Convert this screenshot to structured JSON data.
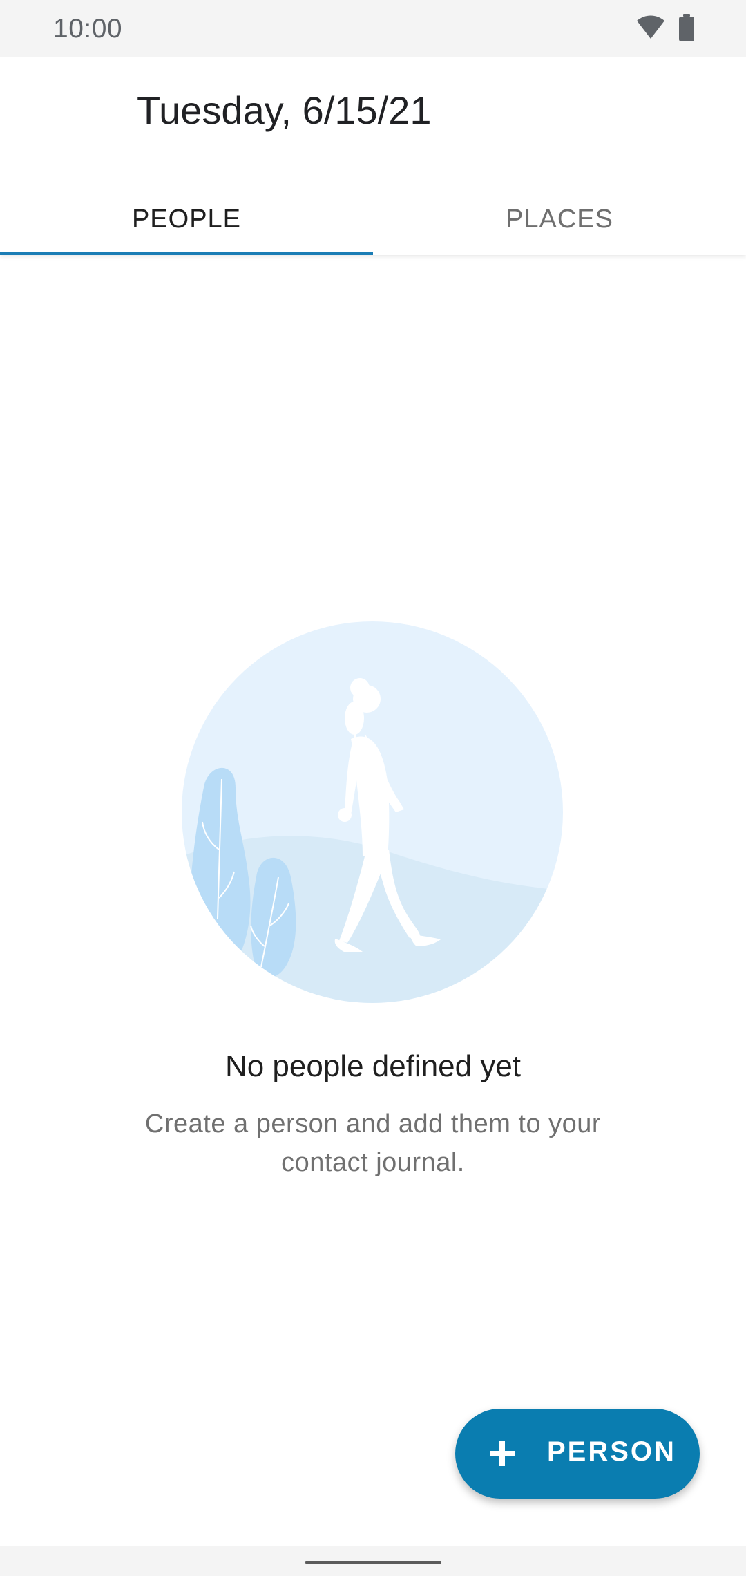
{
  "status_bar": {
    "time": "10:00",
    "icons": [
      "wifi-icon",
      "battery-icon"
    ]
  },
  "header": {
    "title": "Tuesday, 6/15/21"
  },
  "tabs": [
    {
      "label": "PEOPLE",
      "active": true
    },
    {
      "label": "PLACES",
      "active": false
    }
  ],
  "empty_state": {
    "illustration": "person-walking-illustration",
    "title": "No people defined yet",
    "description": "Create a person and add them to your contact journal."
  },
  "fab": {
    "icon": "plus-icon",
    "label": "PERSON"
  },
  "colors": {
    "accent": "#0a7db0",
    "tab_indicator": "#1b7db5",
    "illustration_bg": "#e5f2fd",
    "illustration_hill": "#d7eaf7",
    "illustration_bush": "#b8dcf7"
  }
}
